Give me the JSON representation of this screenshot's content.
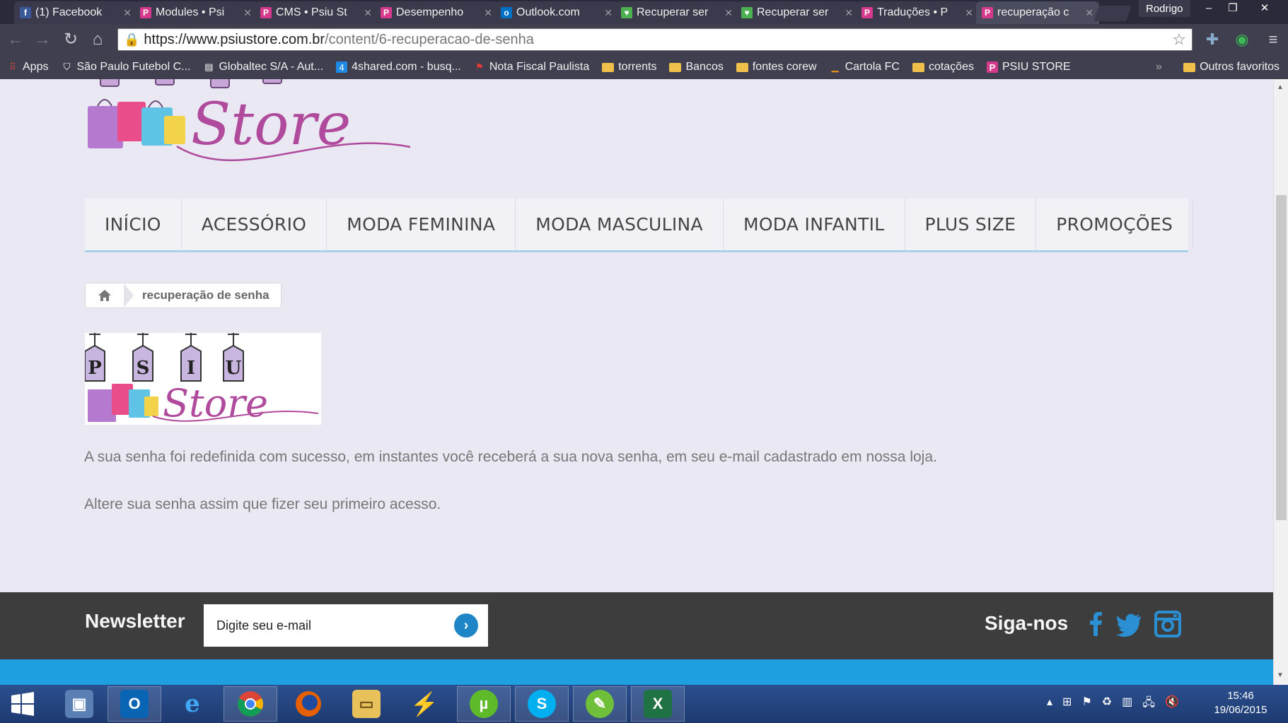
{
  "browser": {
    "tabs": [
      {
        "title": "(1) Facebook",
        "favicon": "facebook-icon",
        "color": "#3b5998",
        "glyph": "f"
      },
      {
        "title": "Modules • Psi",
        "favicon": "prestashop-icon",
        "color": "#d63a8c",
        "glyph": "P"
      },
      {
        "title": "CMS • Psiu St",
        "favicon": "prestashop-icon",
        "color": "#d63a8c",
        "glyph": "P"
      },
      {
        "title": "Desempenho",
        "favicon": "prestashop-icon",
        "color": "#d63a8c",
        "glyph": "P"
      },
      {
        "title": "Outlook.com",
        "favicon": "outlook-icon",
        "color": "#0072c6",
        "glyph": "o"
      },
      {
        "title": "Recuperar ser",
        "favicon": "store-icon",
        "color": "#4caf50",
        "glyph": "♥"
      },
      {
        "title": "Recuperar ser",
        "favicon": "store-icon",
        "color": "#4caf50",
        "glyph": "♥"
      },
      {
        "title": "Traduções • P",
        "favicon": "prestashop-icon",
        "color": "#d63a8c",
        "glyph": "P"
      },
      {
        "title": "recuperação c",
        "favicon": "prestashop-icon",
        "color": "#d63a8c",
        "glyph": "P"
      }
    ],
    "profile": "Rodrigo",
    "url_host": "https://www.psiustore.com.br",
    "url_path": "/content/6-recuperacao-de-senha",
    "bookmarks": [
      {
        "label": "Apps",
        "icon": "apps-grid-icon"
      },
      {
        "label": "São Paulo Futebol C...",
        "icon": "spfc-shield-icon"
      },
      {
        "label": "Globaltec S/A - Aut...",
        "icon": "page-icon"
      },
      {
        "label": "4shared.com - busq...",
        "icon": "4shared-icon"
      },
      {
        "label": "Nota Fiscal Paulista",
        "icon": "flag-icon"
      },
      {
        "label": "torrents",
        "icon": "folder-icon"
      },
      {
        "label": "Bancos",
        "icon": "folder-icon"
      },
      {
        "label": "fontes corew",
        "icon": "folder-icon"
      },
      {
        "label": "Cartola FC",
        "icon": "cartola-icon"
      },
      {
        "label": "cotações",
        "icon": "folder-icon"
      },
      {
        "label": "PSIU STORE",
        "icon": "prestashop-icon"
      }
    ],
    "other_bookmarks": "Outros favoritos"
  },
  "site": {
    "logo_letters": [
      "P",
      "S",
      "I",
      "U"
    ],
    "logo_word": "Store",
    "nav": [
      "INÍCIO",
      "ACESSÓRIO",
      "MODA FEMININA",
      "MODA MASCULINA",
      "MODA INFANTIL",
      "PLUS SIZE",
      "PROMOÇÕES"
    ],
    "breadcrumb": "recuperação de senha",
    "message_1": "A sua senha foi redefinida com sucesso, em instantes você receberá a sua nova senha, em seu e-mail cadastrado em nossa loja.",
    "message_2": "Altere sua senha assim que fizer seu primeiro acesso.",
    "newsletter_label": "Newsletter",
    "newsletter_placeholder": "Digite seu e-mail",
    "follow_label": "Siga-nos"
  },
  "taskbar": {
    "apps": [
      "windows-start",
      "remote-desktop",
      "outlook",
      "internet-explorer",
      "chrome",
      "firefox",
      "file-explorer",
      "winamp",
      "utorrent",
      "skype",
      "corel",
      "excel"
    ],
    "time": "15:46",
    "date": "19/06/2015"
  },
  "colors": {
    "accent_blue": "#1e86c6",
    "logo_purple": "#b04a9c",
    "footer_bg": "#3d3d3d",
    "footer_bar": "#1ea0e0"
  }
}
